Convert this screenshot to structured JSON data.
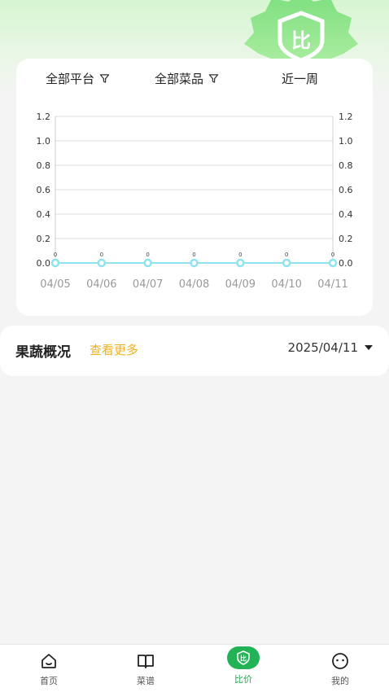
{
  "filters": {
    "platform": "全部平台",
    "dish": "全部菜品",
    "period": "近一周"
  },
  "chart_data": {
    "type": "line",
    "x": [
      "04/05",
      "04/06",
      "04/07",
      "04/08",
      "04/09",
      "04/10",
      "04/11"
    ],
    "series": [
      {
        "values": [
          0,
          0,
          0,
          0,
          0,
          0,
          0
        ]
      }
    ],
    "data_labels": [
      "0",
      "0",
      "0",
      "0",
      "0",
      "0",
      "0"
    ],
    "y_ticks_left": [
      "1.2",
      "1.0",
      "0.8",
      "0.6",
      "0.4",
      "0.2",
      "0.0"
    ],
    "y_ticks_right": [
      "1.2",
      "1.0",
      "0.8",
      "0.6",
      "0.4",
      "0.2",
      "0.0"
    ],
    "ylim": [
      0,
      1.2
    ],
    "grid": true,
    "line_color": "#8fe3ef"
  },
  "overview": {
    "title": "果蔬概况",
    "more_link": "查看更多",
    "date": "2025/04/11"
  },
  "tabbar": {
    "home": "首页",
    "recipes": "菜谱",
    "compare": "比价",
    "mine": "我的"
  },
  "badge": {
    "glyph": "比"
  },
  "colors": {
    "accent": "#22b357",
    "link": "#f2b21c",
    "badge_green": "#5fcf68"
  }
}
